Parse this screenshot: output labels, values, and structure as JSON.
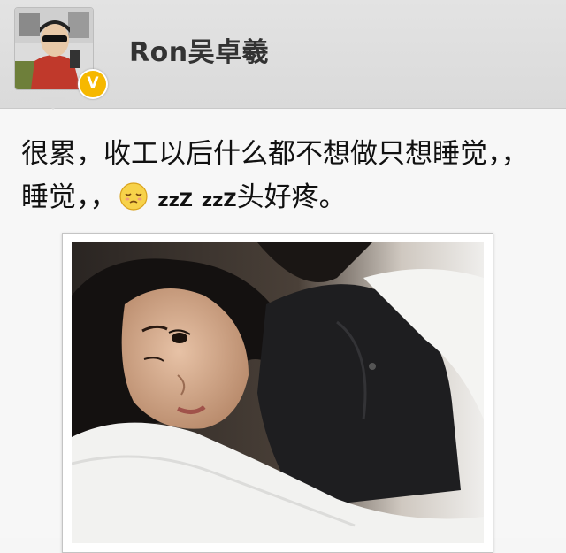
{
  "user": {
    "name": "Ron吴卓羲",
    "verified_badge": "V"
  },
  "post": {
    "text_part1": "很累，收工以后什么都不想做只想睡觉，，睡觉，，",
    "emoji": "sleepy-face-icon",
    "text_zz1": "zzZ",
    "text_zz2": "zzZ",
    "text_part2": "头好疼。"
  },
  "photo": {
    "subject": "woman-lying-on-pillow-photo"
  }
}
